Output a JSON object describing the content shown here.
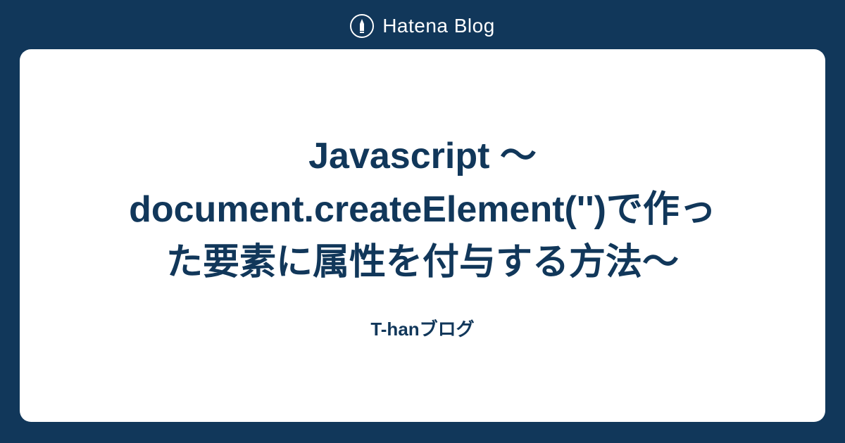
{
  "header": {
    "brand": "Hatena Blog"
  },
  "card": {
    "title": "Javascript ～document.createElement('')で作った要素に属性を付与する方法～",
    "subtitle": "T-hanブログ"
  }
}
